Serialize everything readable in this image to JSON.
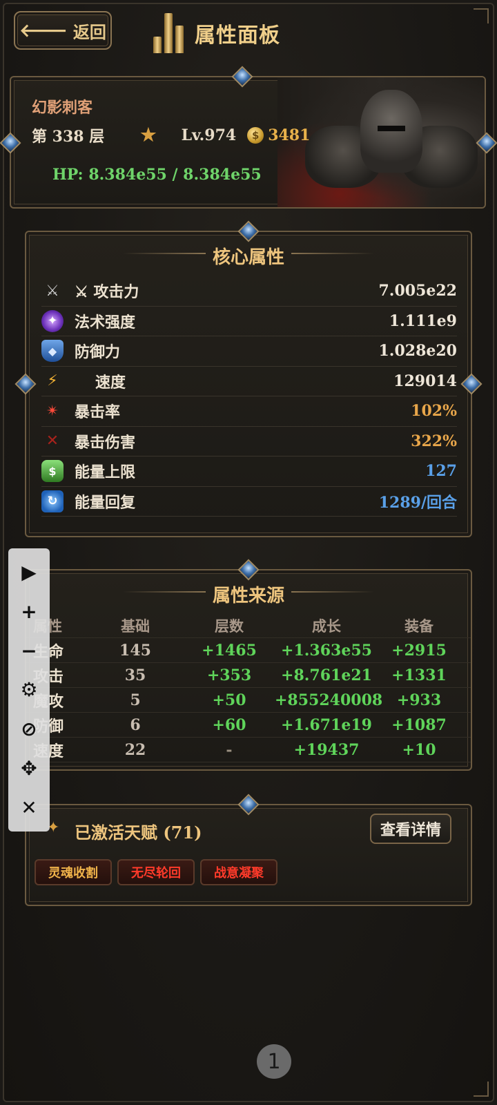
{
  "header": {
    "back_label": "返回",
    "title": "属性面板"
  },
  "character": {
    "name": "幻影刺客",
    "floor": "第 338 层",
    "level": "Lv.974",
    "gold": "3481",
    "hp": "HP: 8.384e55 / 8.384e55"
  },
  "core": {
    "title": "核心属性",
    "stats": [
      {
        "label": "⚔ 攻击力",
        "value": "7.005e22",
        "icon": "sword-icon"
      },
      {
        "label": "法术强度",
        "value": "1.111e9",
        "icon": "magic-icon"
      },
      {
        "label": "防御力",
        "value": "1.028e20",
        "icon": "shield-icon"
      },
      {
        "label": "速度",
        "value": "129014",
        "icon": "lightning-icon"
      },
      {
        "label": "暴击率",
        "value": "102%",
        "icon": "crit-icon"
      },
      {
        "label": "暴击伤害",
        "value": "322%",
        "icon": "crit-damage-icon"
      },
      {
        "label": "能量上限",
        "value": "127",
        "icon": "energy-bag-icon"
      },
      {
        "label": "能量回复",
        "value": "1289/回合",
        "icon": "regen-icon"
      }
    ]
  },
  "sources": {
    "title": "属性来源",
    "headers": [
      "属性",
      "基础",
      "层数",
      "成长",
      "装备"
    ],
    "rows": [
      [
        "生命",
        "145",
        "+1465",
        "+1.363e55",
        "+2915"
      ],
      [
        "攻击",
        "35",
        "+353",
        "+8.761e21",
        "+1331"
      ],
      [
        "魔攻",
        "5",
        "+50",
        "+855240008",
        "+933"
      ],
      [
        "防御",
        "6",
        "+60",
        "+1.671e19",
        "+1087"
      ],
      [
        "速度",
        "22",
        "-",
        "+19437",
        "+10"
      ]
    ]
  },
  "talents": {
    "title": "已激活天赋 (71)",
    "detail_label": "查看详情",
    "tags": [
      "灵魂收割",
      "无尽轮回",
      "战意凝聚"
    ]
  },
  "toolbar": {
    "play": "▶",
    "zoom_in": "+",
    "zoom_out": "−",
    "settings": "⚙",
    "hide": "⊘",
    "move": "✥",
    "close": "✕"
  },
  "pager": {
    "page": "1"
  },
  "colors": {
    "gold": "#eec57e",
    "green": "#5fd45a",
    "blue": "#5aa0e8",
    "orange": "#e8a64a",
    "red": "#ff3a2a"
  }
}
